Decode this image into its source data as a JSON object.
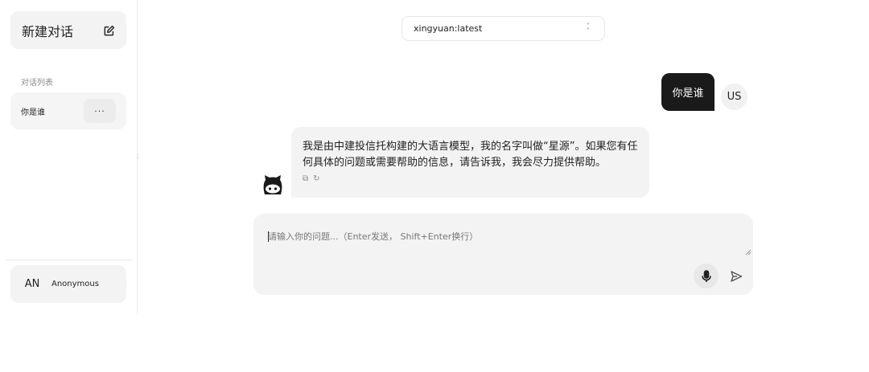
{
  "sidebar": {
    "new_chat_label": "新建对话",
    "new_chat_icon": "edit-icon",
    "section_title": "对话列表",
    "conversations": [
      {
        "label": "你是谁",
        "more_label": "···"
      }
    ],
    "user": {
      "avatar_initials": "AN",
      "name": "Anonymous"
    }
  },
  "header": {
    "model_selected": "xingyuan:latest",
    "model_icon": "chevron-up-down-icon"
  },
  "messages": [
    {
      "role": "user",
      "text": "你是谁",
      "avatar_initials": "US"
    },
    {
      "role": "assistant",
      "text": "我是由中建投信托构建的大语言模型，我的名字叫做“星源”。如果您有任何具体的问题或需要帮助的信息，请告诉我，我会尽力提供帮助。",
      "actions": [
        {
          "icon": "copy-icon",
          "glyph": "⧉"
        },
        {
          "icon": "regenerate-icon",
          "glyph": "↻"
        }
      ],
      "avatar_icon": "github-octocat-icon"
    }
  ],
  "input": {
    "placeholder": "请输入你的问题...（Enter发送， Shift+Enter换行）",
    "value": "",
    "mic_icon": "microphone-icon",
    "send_icon": "send-icon"
  },
  "colors": {
    "user_bubble": "#1a1a1a",
    "panel_bg": "#f3f3f3",
    "text": "#1f1f1f"
  }
}
